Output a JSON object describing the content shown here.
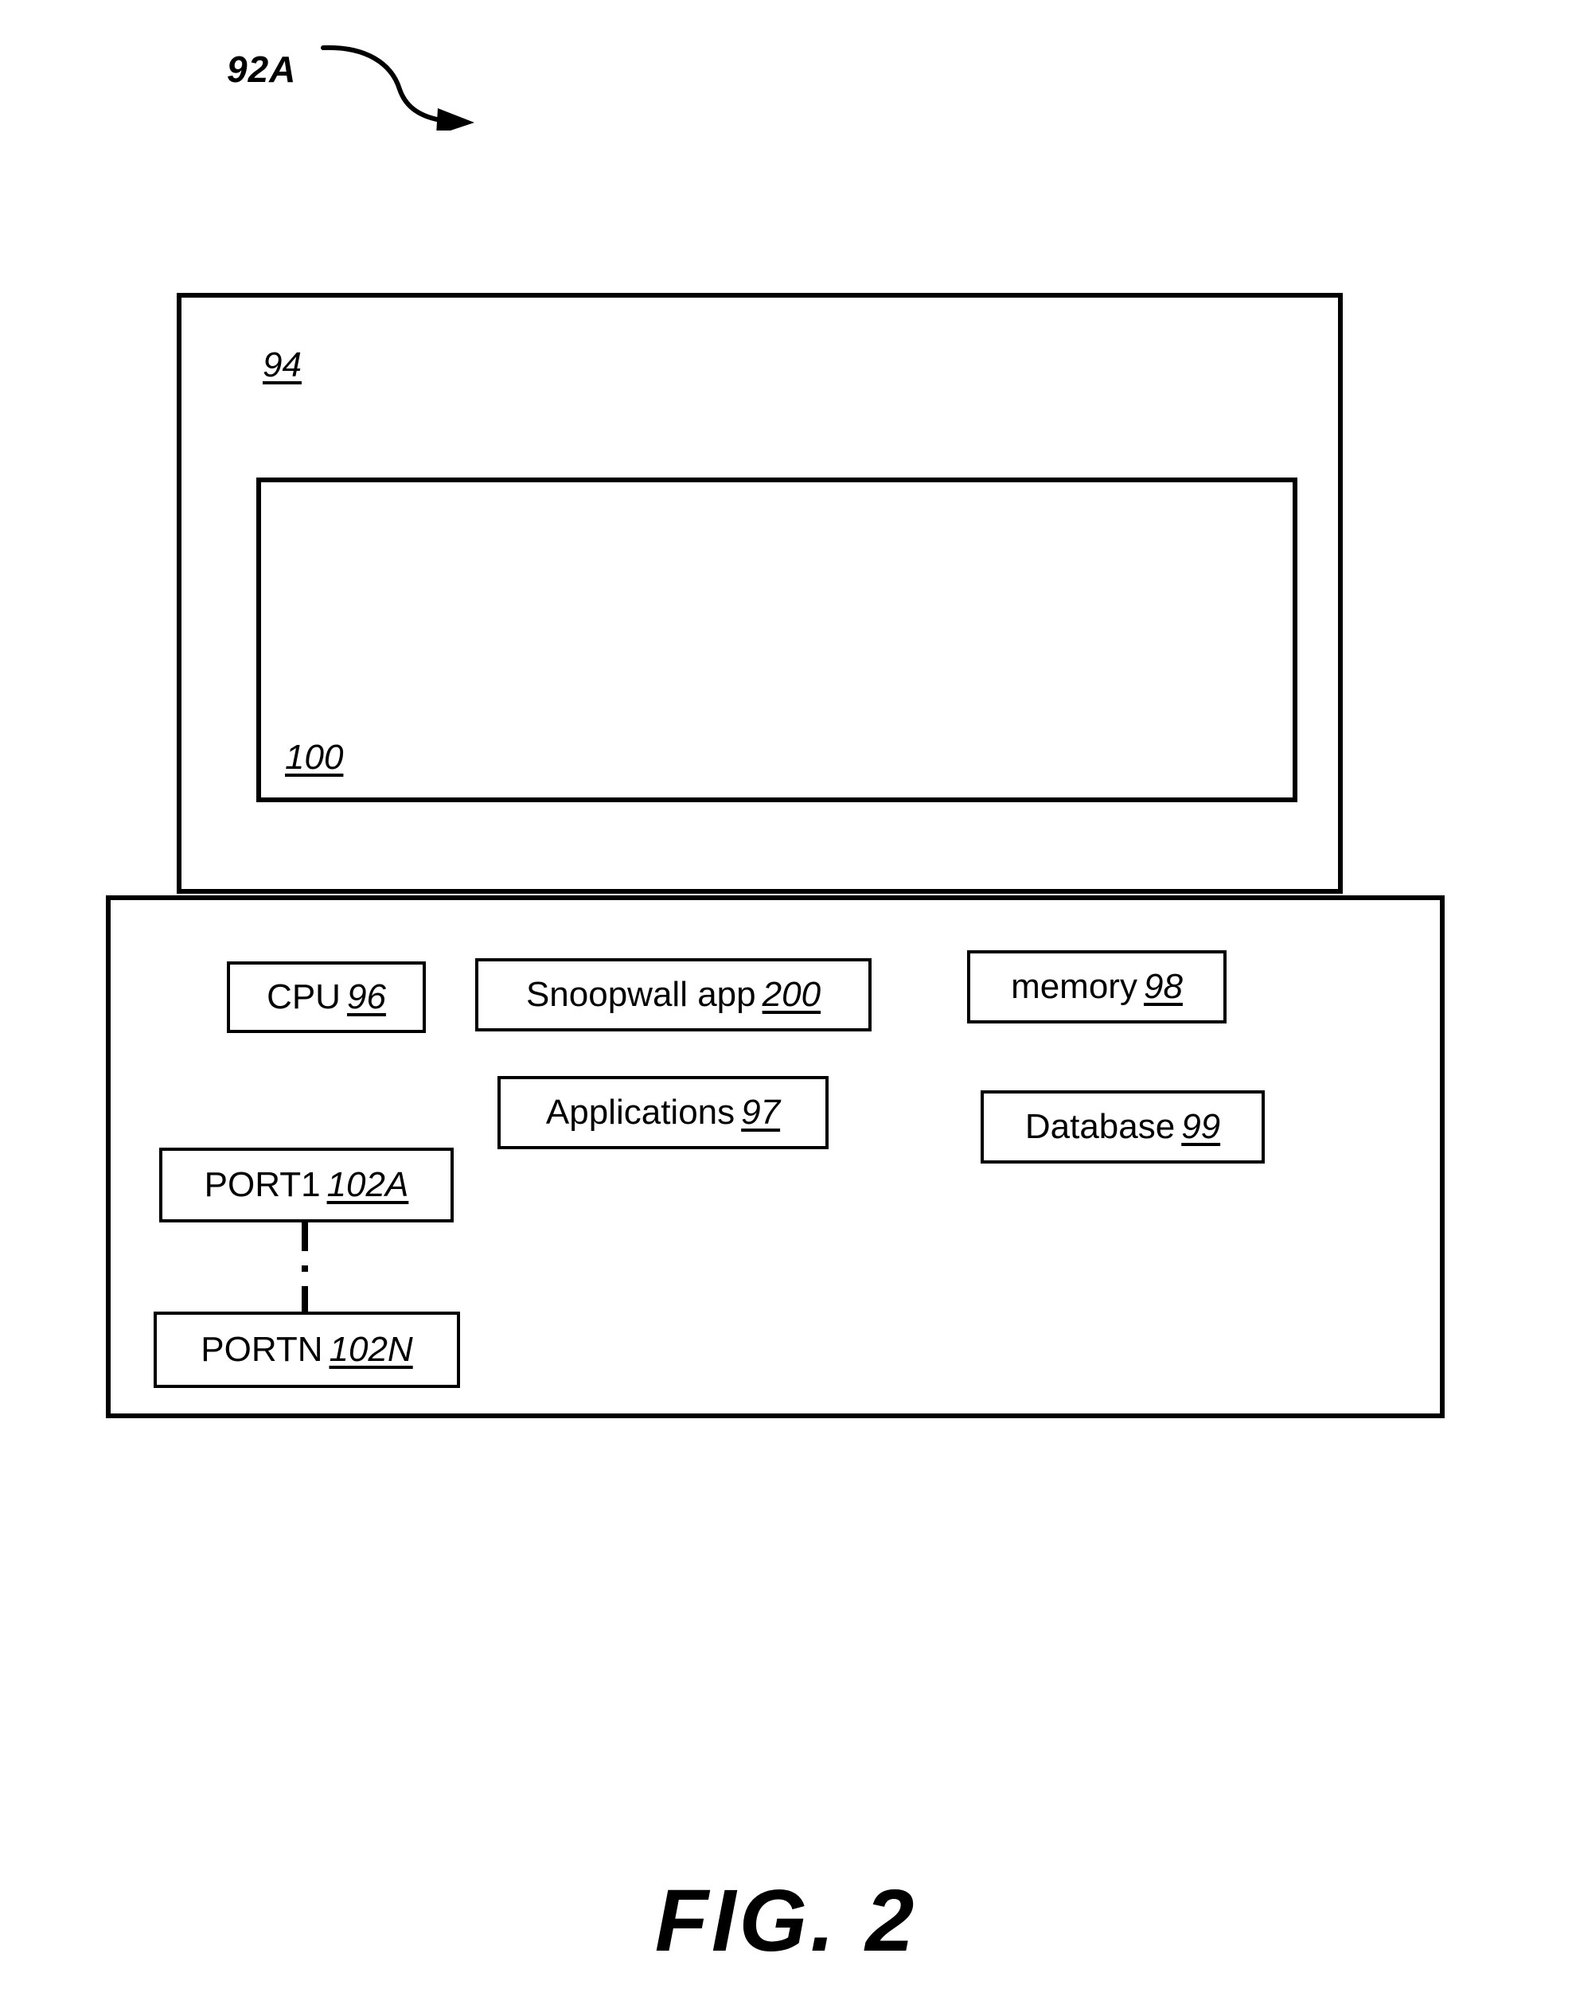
{
  "figure": {
    "identifier": "92A",
    "caption": "FIG. 2",
    "ink_color": "#000000",
    "background_color": "#ffffff"
  },
  "diagram": {
    "monitor": {
      "name": "display-enclosure",
      "ref": "94"
    },
    "screen": {
      "name": "display-screen",
      "ref": "100"
    },
    "body": {
      "name": "computing-device-chassis"
    },
    "components": [
      {
        "key": "cpu",
        "label": "CPU",
        "ref": "96"
      },
      {
        "key": "snoopwall",
        "label": "Snoopwall app",
        "ref": "200"
      },
      {
        "key": "memory",
        "label": "memory",
        "ref": "98"
      },
      {
        "key": "applications",
        "label": "Applications",
        "ref": "97"
      },
      {
        "key": "database",
        "label": "Database",
        "ref": "99"
      },
      {
        "key": "port1",
        "label": "PORT1",
        "ref": "102A"
      },
      {
        "key": "portn",
        "label": "PORTN",
        "ref": "102N"
      }
    ],
    "connector": {
      "name": "port-series-connector",
      "style": "dash-dot",
      "from": "port1",
      "to": "portn"
    }
  }
}
